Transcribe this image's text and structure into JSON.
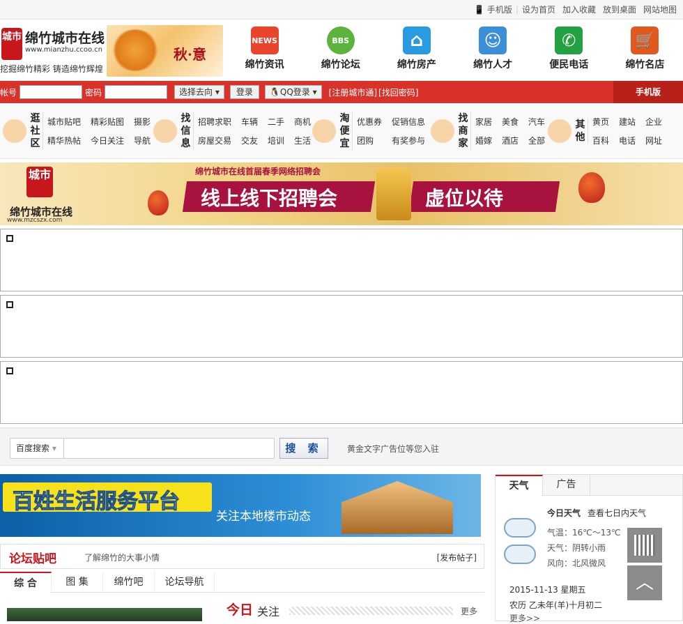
{
  "topbar": {
    "links": [
      "手机版",
      "设为首页",
      "加入收藏",
      "放到桌面",
      "网站地图"
    ]
  },
  "logo": {
    "seal": "城市",
    "name": "绵竹城市在线",
    "url": "www.mianzhu.ccoo.cn",
    "slogan": "挖掘绵竹精彩 铸造绵竹辉煌",
    "season": "秋·意"
  },
  "nav": [
    {
      "label": "绵竹资讯",
      "icon": "news-icon",
      "iconText": "NEWS",
      "color": "#e8452c"
    },
    {
      "label": "绵竹论坛",
      "icon": "bbs-icon",
      "iconText": "BBS",
      "color": "#5bb33d"
    },
    {
      "label": "绵竹房产",
      "icon": "house-icon",
      "iconText": "⌂",
      "color": "#2a9be0"
    },
    {
      "label": "绵竹人才",
      "icon": "people-icon",
      "iconText": "☺",
      "color": "#3a8fd8"
    },
    {
      "label": "便民电话",
      "icon": "phone-icon",
      "iconText": "✆",
      "color": "#23a143"
    },
    {
      "label": "绵竹名店",
      "icon": "cart-icon",
      "iconText": "🛒",
      "color": "#e05a1f"
    }
  ],
  "login": {
    "account_label": "帐号",
    "password_label": "密码",
    "select_label": "选择去向",
    "login_button": "登录",
    "qq_login": "QQ登录",
    "register": "[注册城市通]",
    "find_password": "[找回密码]",
    "mobile": "手机版"
  },
  "categories": [
    {
      "title": "逛社区",
      "icon": "chat-icon",
      "links": [
        "城市贴吧",
        "精彩贴图",
        "摄影",
        "精华热帖",
        "今日关注",
        "导航"
      ]
    },
    {
      "title": "找信息",
      "icon": "cup-icon",
      "links": [
        "招聘求职",
        "车辆",
        "二手",
        "商机",
        "房屋交易",
        "交友",
        "培训",
        "生活"
      ]
    },
    {
      "title": "淘便宜",
      "icon": "basket-icon",
      "links": [
        "优惠券",
        "促销信息",
        "团购",
        "有奖参与"
      ]
    },
    {
      "title": "找商家",
      "icon": "pin-icon",
      "links": [
        "家居",
        "美食",
        "汽车",
        "婚嫁",
        "酒店",
        "全部"
      ]
    },
    {
      "title": "其他",
      "icon": "location-icon",
      "links": [
        "黄页",
        "建站",
        "企业",
        "百科",
        "电话",
        "网址"
      ]
    }
  ],
  "banner": {
    "seal": "城市",
    "name": "绵竹城市在线",
    "url": "www.mzcszx.com",
    "subtitle": "绵竹城市在线首届春季网络招聘会",
    "headline1": "线上线下招聘会",
    "headline2": "虚位以待"
  },
  "search": {
    "engine": "百度搜索",
    "button": "搜 索",
    "ad_text": "黄金文字广告位等您入驻"
  },
  "service_banner": {
    "title": "百姓生活服务平台",
    "subtitle": "关注本地楼市动态"
  },
  "forum": {
    "title": "论坛贴吧",
    "desc": "了解绵竹的大事小情",
    "post": "[发布帖子]",
    "tabs": [
      "综 合",
      "图 集",
      "绵竹吧",
      "论坛导航"
    ]
  },
  "today": {
    "title": "今日",
    "subtitle": "关注",
    "more": "更多"
  },
  "weather": {
    "tabs": [
      "天气",
      "广告"
    ],
    "today": "今日天气",
    "week": "查看七日内天气",
    "temp": "气温：16℃～13℃",
    "cond": "天气：阴转小雨",
    "wind": "风向：北风微风",
    "date": "2015-11-13 星期五",
    "lunar": "农历 乙未年(羊)十月初二",
    "more": "更多>>"
  }
}
